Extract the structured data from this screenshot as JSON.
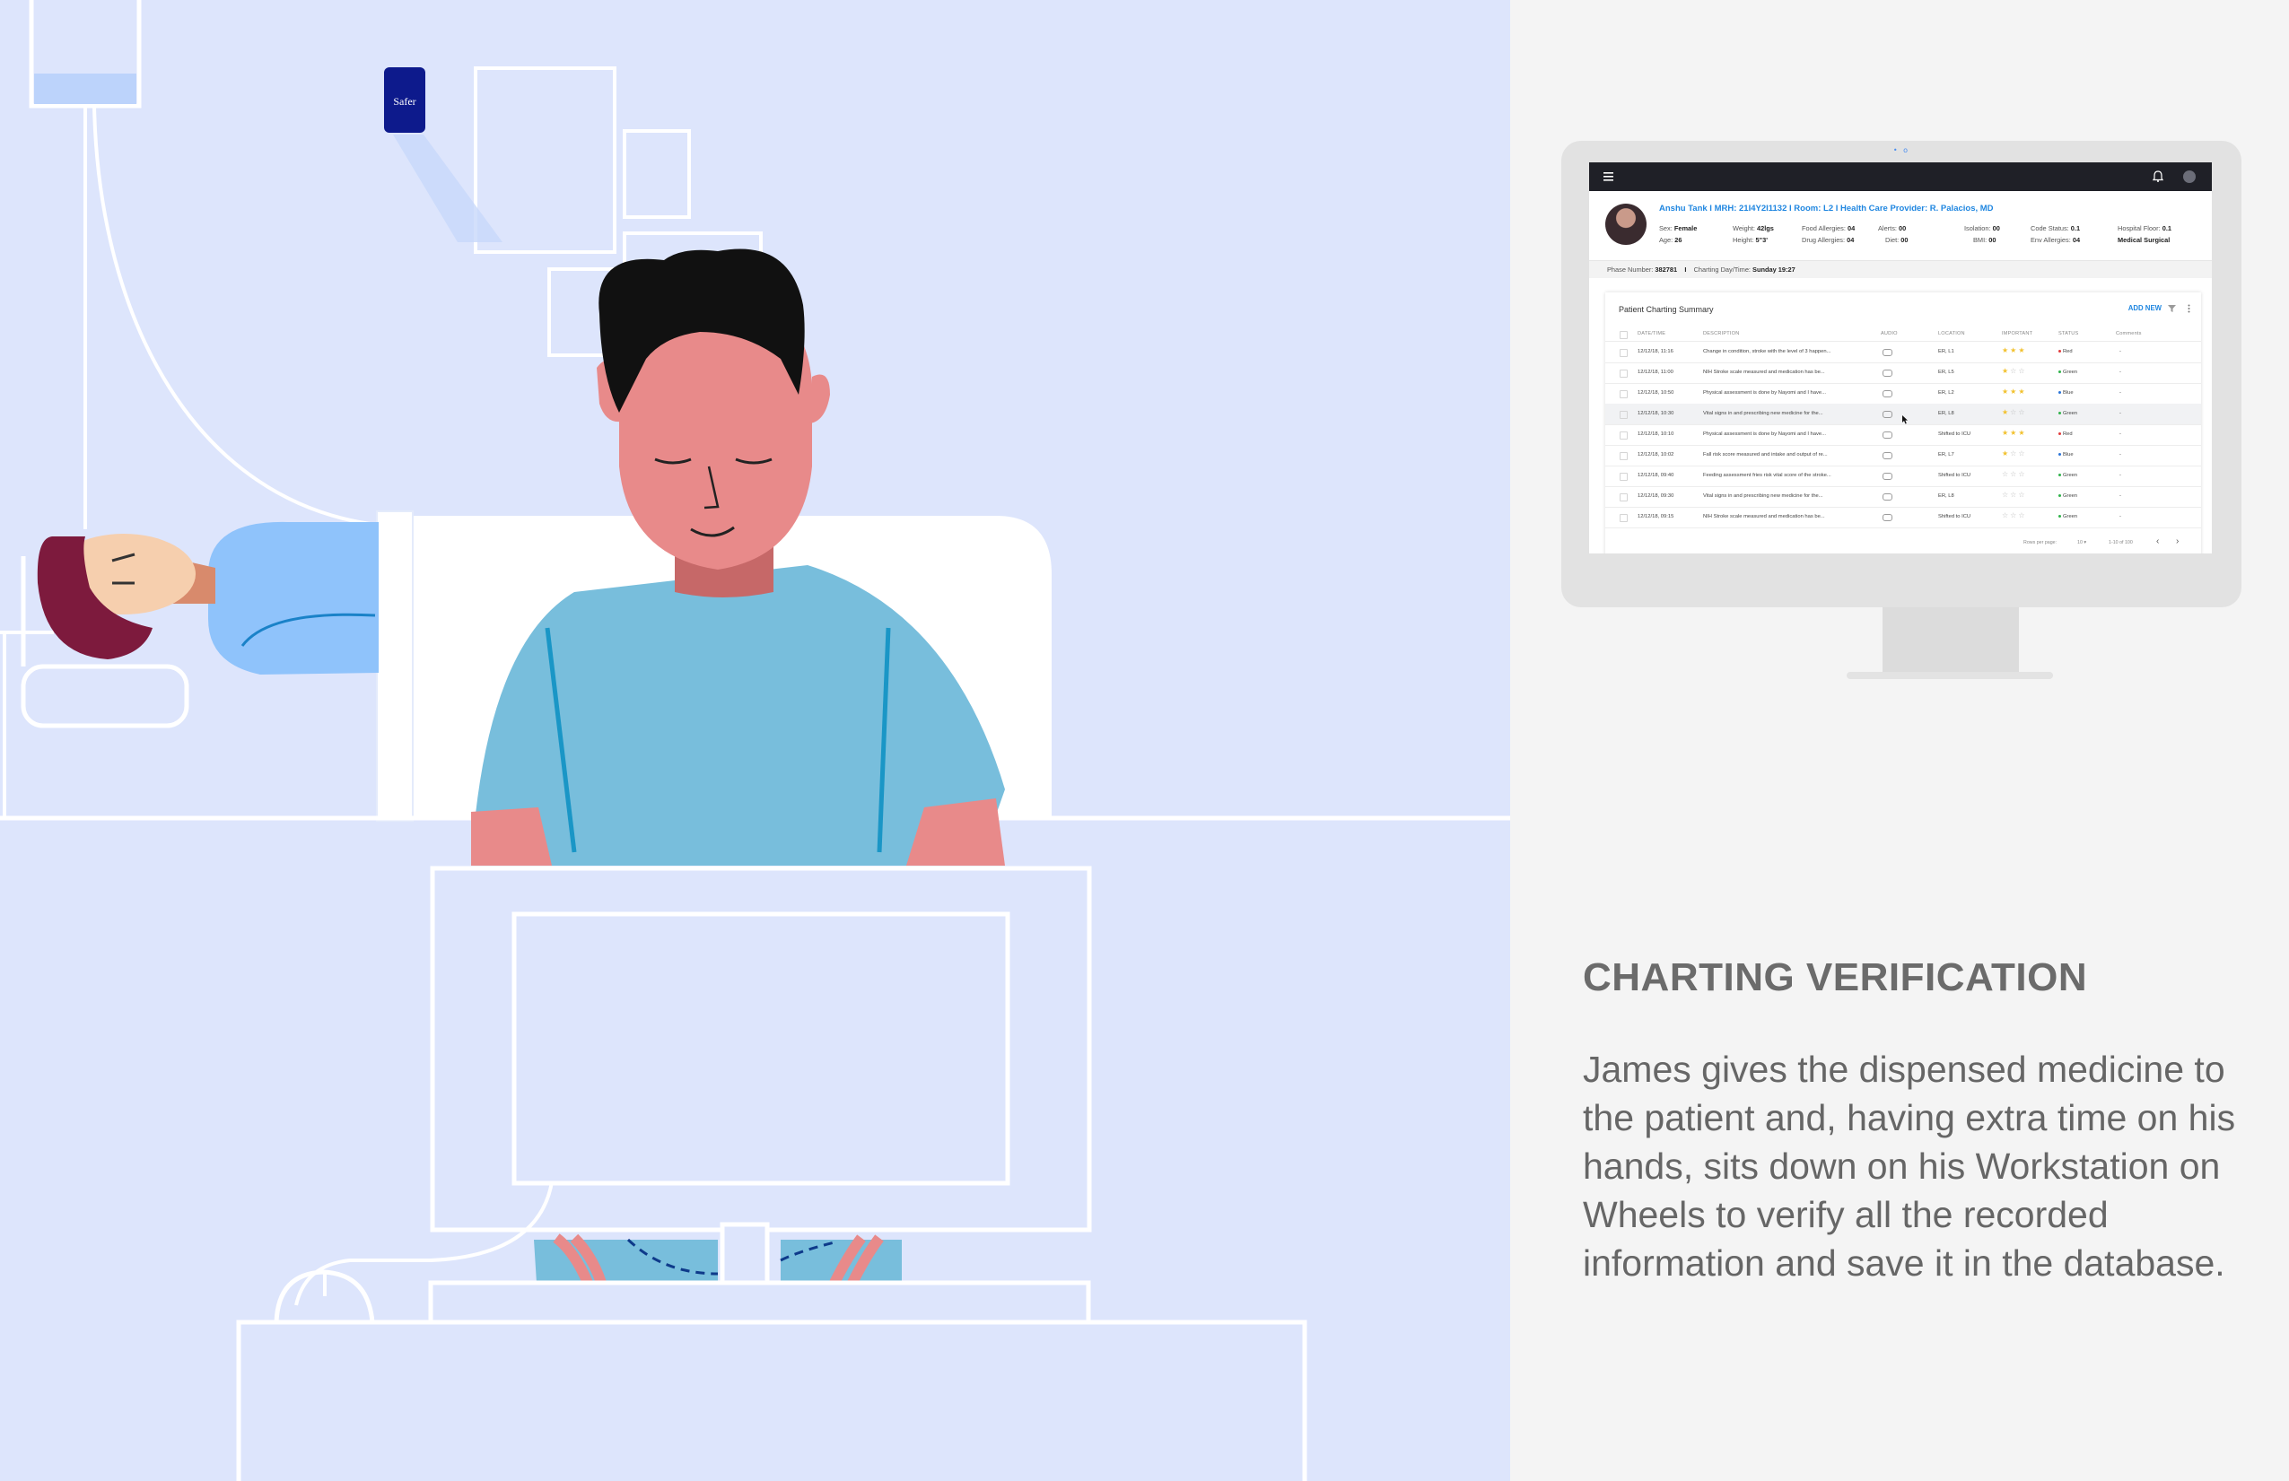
{
  "illustration": {
    "dispenser_label": "Safer"
  },
  "app": {
    "patient_header": "Anshu Tank  I  MRH: 21I4Y2I1132  I  Room: L2  I  Health Care Provider: R. Palacios, MD",
    "fields": {
      "sex_label": "Sex:",
      "sex": "Female",
      "age_label": "Age:",
      "age": "26",
      "weight_label": "Weight:",
      "weight": "42lgs",
      "height_label": "Height:",
      "height": "5\"3'",
      "food_allergies_label": "Food Allergies:",
      "food_allergies": "04",
      "drug_allergies_label": "Drug Allergies:",
      "drug_allergies": "04",
      "alerts_label": "Alerts:",
      "alerts": "00",
      "diet_label": "Diet:",
      "diet": "00",
      "isolation_label": "Isolation:",
      "isolation": "00",
      "bmi_label": "BMI:",
      "bmi": "00",
      "code_status_label": "Code Status:",
      "code_status": "0.1",
      "env_allergies_label": "Env Allergies:",
      "env_allergies": "04",
      "hospital_floor_label": "Hospital Floor:",
      "hospital_floor": "0.1",
      "unit": "Medical Surgical"
    },
    "phase_label": "Phase Number:",
    "phase_number": "382781",
    "phase_sep": "I",
    "charting_label": "Charting Day/Time:",
    "charting_value": "Sunday 19:27",
    "card_title": "Patient Charting Summary",
    "add_new": "ADD NEW",
    "columns": [
      "DATE/TIME",
      "DESCRIPTION",
      "AUDIO",
      "LOCATION",
      "IMPORTANT",
      "STATUS",
      "Comments"
    ],
    "rows": [
      {
        "date": "12/12/18, 11:16",
        "desc": "Change in condition, stroke with the level of 3 happen...",
        "loc": "ER, L1",
        "stars": 3,
        "status": "Red",
        "status_color": "#e23b3b",
        "comment": "-"
      },
      {
        "date": "12/12/18, 11:00",
        "desc": "NIH Stroke scale measured and medication has be...",
        "loc": "ER, L5",
        "stars": 1,
        "status": "Green",
        "status_color": "#2fb24a",
        "comment": "-"
      },
      {
        "date": "12/12/18, 10:50",
        "desc": "Physical assessment is done by Nayomi and I have...",
        "loc": "ER, L2",
        "stars": 3,
        "status": "Blue",
        "status_color": "#2a74d8",
        "comment": "-"
      },
      {
        "date": "12/12/18, 10:30",
        "desc": "Vital signs in and prescribing new medicine for the...",
        "loc": "ER, L8",
        "stars": 1,
        "status": "Green",
        "status_color": "#2fb24a",
        "comment": "-"
      },
      {
        "date": "12/12/18, 10:10",
        "desc": "Physical assessment is done by Nayomi and I have...",
        "loc": "Shifted to ICU",
        "stars": 3,
        "status": "Red",
        "status_color": "#e23b3b",
        "comment": "-"
      },
      {
        "date": "12/12/18, 10:02",
        "desc": "Fall risk score measured and intake and output of re...",
        "loc": "ER, L7",
        "stars": 1,
        "status": "Blue",
        "status_color": "#2a74d8",
        "comment": "-"
      },
      {
        "date": "12/12/18, 09:40",
        "desc": "Feeding assessment fries risk vital score of the stroke...",
        "loc": "Shifted to ICU",
        "stars": 0,
        "status": "Green",
        "status_color": "#2fb24a",
        "comment": "-"
      },
      {
        "date": "12/12/18, 09:30",
        "desc": "Vital signs in and prescribing new medicine for the...",
        "loc": "ER, L8",
        "stars": 0,
        "status": "Green",
        "status_color": "#2fb24a",
        "comment": "-"
      },
      {
        "date": "12/12/18, 09:15",
        "desc": "NIH Stroke scale measured and medication has be...",
        "loc": "Shifted to ICU",
        "stars": 0,
        "status": "Green",
        "status_color": "#2fb24a",
        "comment": "-"
      }
    ],
    "footer_rows_label": "Rows per page:",
    "footer_rows_value": "10",
    "footer_range": "1-10 of 100",
    "prev": "‹",
    "next": "›"
  },
  "heading": "CHARTING VERIFICATION",
  "body": "James gives the dispensed medicine to the patient and, having extra time on his hands, sits down on his Workstation on Wheels to verify all the recorded information and save it in the database.",
  "colors": {
    "illustration_bg": "#dde5fc",
    "line": "#ffffff",
    "skin": "#e88a8a",
    "shirt": "#78bedc",
    "hair": "#111111",
    "accent_blue": "#1f86e0",
    "dispenser": "#0d1a8c"
  }
}
